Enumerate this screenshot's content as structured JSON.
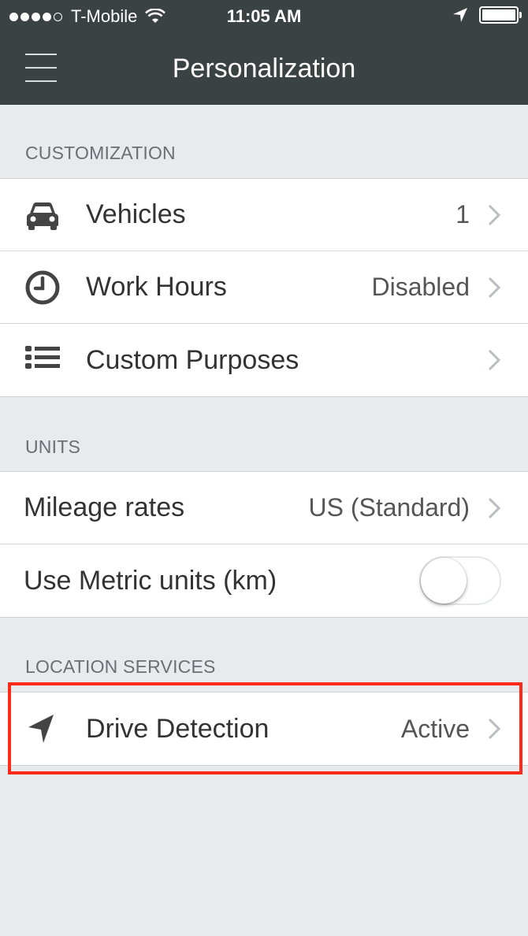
{
  "status_bar": {
    "carrier": "T-Mobile",
    "time": "11:05 AM",
    "signal_bars_filled": 4,
    "signal_bars_total": 5,
    "battery_level": 1.0
  },
  "header": {
    "title": "Personalization"
  },
  "sections": {
    "customization": {
      "header": "CUSTOMIZATION",
      "vehicles": {
        "label": "Vehicles",
        "value": "1"
      },
      "work_hours": {
        "label": "Work Hours",
        "value": "Disabled"
      },
      "custom_purposes": {
        "label": "Custom Purposes"
      }
    },
    "units": {
      "header": "UNITS",
      "mileage_rates": {
        "label": "Mileage rates",
        "value": "US (Standard)"
      },
      "metric_units": {
        "label": "Use Metric units (km)",
        "enabled": false
      }
    },
    "location_services": {
      "header": "LOCATION SERVICES",
      "drive_detection": {
        "label": "Drive Detection",
        "value": "Active"
      }
    }
  },
  "colors": {
    "header_bg": "#3b4244",
    "page_bg": "#e8ebee",
    "highlight": "#ff2a1a"
  },
  "icons": {
    "vehicles": "car-icon",
    "work_hours": "clock-icon",
    "custom_purposes": "list-icon",
    "drive_detection": "location-arrow-icon"
  }
}
